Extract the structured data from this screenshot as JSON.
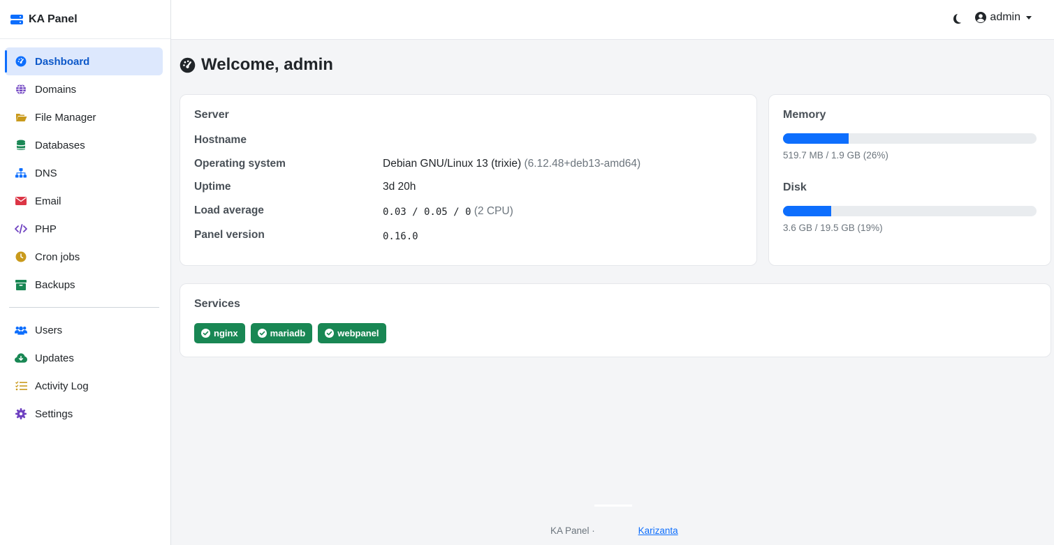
{
  "brand": {
    "name": "KA Panel"
  },
  "sidebar": {
    "items": [
      {
        "label": "Dashboard",
        "icon": "dashboard-icon",
        "color": "#0d6efd",
        "active": true
      },
      {
        "label": "Domains",
        "icon": "globe-icon",
        "color": "#6f42c1"
      },
      {
        "label": "File Manager",
        "icon": "folder-open-icon",
        "color": "#c99a1c"
      },
      {
        "label": "Databases",
        "icon": "database-icon",
        "color": "#198754"
      },
      {
        "label": "DNS",
        "icon": "sitemap-icon",
        "color": "#0d6efd"
      },
      {
        "label": "Email",
        "icon": "envelope-icon",
        "color": "#dc3545"
      },
      {
        "label": "PHP",
        "icon": "code-icon",
        "color": "#6f42c1"
      },
      {
        "label": "Cron jobs",
        "icon": "clock-icon",
        "color": "#c99a1c"
      },
      {
        "label": "Backups",
        "icon": "archive-icon",
        "color": "#198754"
      }
    ],
    "items2": [
      {
        "label": "Users",
        "icon": "users-icon",
        "color": "#0d6efd"
      },
      {
        "label": "Updates",
        "icon": "cloud-download-icon",
        "color": "#198754"
      },
      {
        "label": "Activity Log",
        "icon": "list-check-icon",
        "color": "#c99a1c"
      },
      {
        "label": "Settings",
        "icon": "gear-icon",
        "color": "#6f42c1"
      }
    ]
  },
  "topbar": {
    "user": "admin"
  },
  "main": {
    "title": "Welcome, admin",
    "server": {
      "heading": "Server",
      "hostname_label": "Hostname",
      "hostname_value": "",
      "os_label": "Operating system",
      "os_value": "Debian GNU/Linux 13 (trixie)",
      "os_kernel": "(6.12.48+deb13-amd64)",
      "uptime_label": "Uptime",
      "uptime_value": "3d 20h",
      "load_label": "Load average",
      "load_value": "0.03 / 0.05 / 0",
      "load_cpu": "(2 CPU)",
      "version_label": "Panel version",
      "version_value": "0.16.0"
    },
    "memory": {
      "label": "Memory",
      "text": "519.7 MB / 1.9 GB (26%)",
      "percent": 26
    },
    "disk": {
      "label": "Disk",
      "text": "3.6 GB / 19.5 GB (19%)",
      "percent": 19
    },
    "services": {
      "heading": "Services",
      "items": [
        "nginx",
        "mariadb",
        "webpanel"
      ],
      "color": "#198754"
    }
  },
  "footer": {
    "text": "KA Panel ·",
    "link": "Karizanta"
  }
}
